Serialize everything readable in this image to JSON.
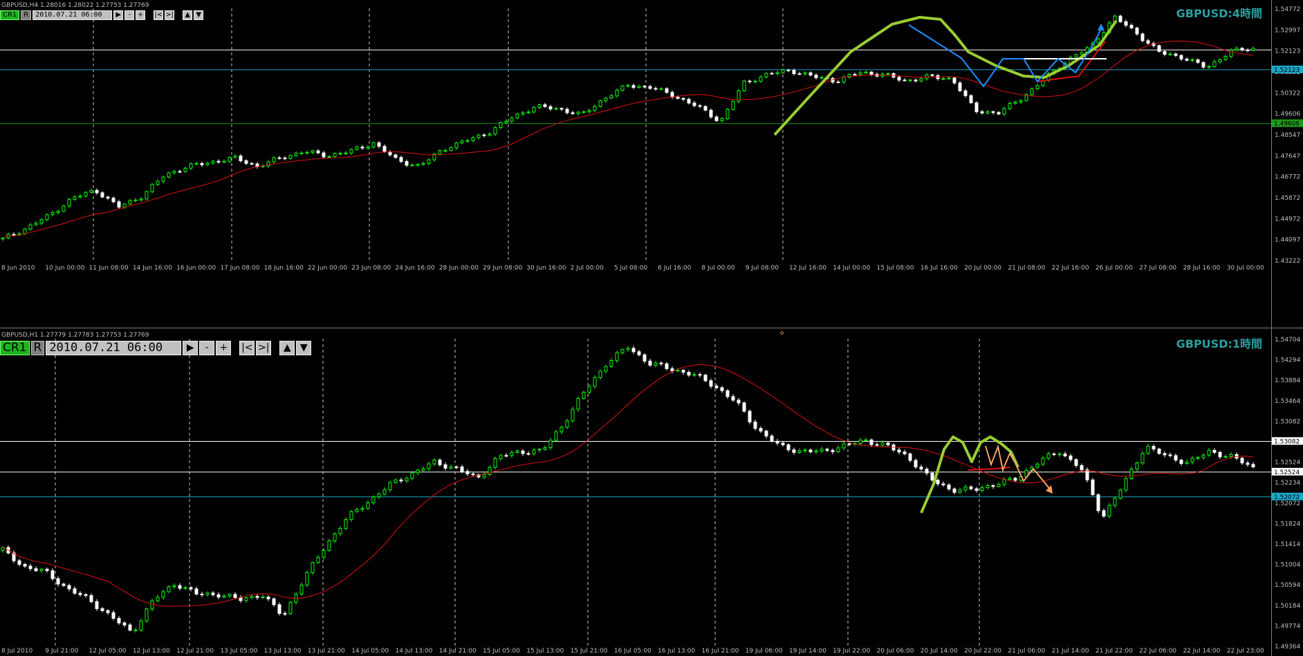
{
  "panels": [
    {
      "header": "GBPUSD,H4  1.28016 1.28022 1.27753 1.27769",
      "watermark": "GBPUSD:4時間",
      "toolbar": {
        "tag": "CR1",
        "r": "R",
        "datetime": "2010.07.21 06:00",
        "btn_next": "▶",
        "btn_minus": "-",
        "btn_plus": "+",
        "btn_first": "|<",
        "btn_last": ">|",
        "btn_up": "▲",
        "btn_down": "▼"
      },
      "price_labels": [
        "1.54772",
        "1.52997",
        "1.52123",
        "1.51222",
        "1.50322",
        "1.49606",
        "1.48547",
        "1.47647",
        "1.46772",
        "1.45872",
        "1.44972",
        "1.44097",
        "1.43222"
      ],
      "time_labels": [
        "8 Jun 2010",
        "10 Jun 00:00",
        "11 Jun 08:00",
        "14 Jun 16:00",
        "16 Jun 00:00",
        "17 Jun 08:00",
        "18 Jun 16:00",
        "22 Jun 00:00",
        "23 Jun 08:00",
        "24 Jun 16:00",
        "28 Jun 00:00",
        "29 Jun 08:00",
        "30 Jun 16:00",
        "2 Jul 00:00",
        "5 Jul 08:00",
        "6 Jul 16:00",
        "8 Jul 00:00",
        "9 Jul 08:00",
        "12 Jul 16:00",
        "14 Jul 00:00",
        "15 Jul 08:00",
        "16 Jul 16:00",
        "20 Jul 00:00",
        "21 Jul 08:00",
        "22 Jul 16:00",
        "26 Jul 00:00",
        "27 Jul 08:00",
        "28 Jul 16:00",
        "30 Jul 00:00"
      ],
      "level_tags": [
        {
          "text": "1.52123",
          "color": "#1aa7c8"
        },
        {
          "text": "1.49606",
          "color": "#1c9a1c"
        }
      ],
      "chart_data": {
        "type": "candlestick",
        "symbol": "GBPUSD",
        "timeframe": "H4",
        "ylim": [
          1.43222,
          1.55
        ],
        "horizontal_levels": [
          {
            "price": 1.52123,
            "color": "#1aa7c8"
          },
          {
            "price": 1.49606,
            "color": "#1c9a1c"
          },
          {
            "price": 1.5305,
            "color": "#ffffff"
          }
        ],
        "close_path": [
          1.442,
          1.447,
          1.453,
          1.461,
          1.465,
          1.457,
          1.462,
          1.472,
          1.476,
          1.478,
          1.48,
          1.476,
          1.48,
          1.483,
          1.481,
          1.483,
          1.487,
          1.479,
          1.476,
          1.484,
          1.488,
          1.492,
          1.499,
          1.504,
          1.503,
          1.5,
          1.508,
          1.514,
          1.513,
          1.509,
          1.504,
          1.497,
          1.515,
          1.519,
          1.521,
          1.518,
          1.516,
          1.52,
          1.519,
          1.516,
          1.518,
          1.517,
          1.502,
          1.501,
          1.508,
          1.517,
          1.526,
          1.532,
          1.546,
          1.538,
          1.529,
          1.527,
          1.522,
          1.53,
          1.531
        ]
      }
    },
    {
      "header": "GBPUSD,H1  1.27779 1.27783 1.27753 1.27769",
      "watermark": "GBPUSD:1時間",
      "toolbar": {
        "tag": "CR1",
        "r": "R",
        "datetime": "2010.07.21 06:00",
        "btn_next": "▶",
        "btn_minus": "-",
        "btn_plus": "+",
        "btn_first": "|<",
        "btn_last": ">|",
        "btn_up": "▲",
        "btn_down": "▼"
      },
      "price_labels": [
        "1.54704",
        "1.54294",
        "1.53884",
        "1.53464",
        "1.53082",
        "1.52644",
        "1.52524",
        "1.52234",
        "1.52072",
        "1.51824",
        "1.51414",
        "1.51004",
        "1.50594",
        "1.50184",
        "1.49774",
        "1.49364"
      ],
      "time_labels": [
        "8 Jul 2010",
        "9 Jul 21:00",
        "12 Jul 05:00",
        "12 Jul 13:00",
        "12 Jul 21:00",
        "13 Jul 05:00",
        "13 Jul 13:00",
        "13 Jul 21:00",
        "14 Jul 05:00",
        "14 Jul 13:00",
        "14 Jul 21:00",
        "15 Jul 05:00",
        "15 Jul 13:00",
        "15 Jul 21:00",
        "16 Jul 05:00",
        "16 Jul 13:00",
        "16 Jul 21:00",
        "19 Jul 06:00",
        "19 Jul 14:00",
        "19 Jul 22:00",
        "20 Jul 06:00",
        "20 Jul 14:00",
        "20 Jul 22:00",
        "21 Jul 06:00",
        "21 Jul 14:00",
        "21 Jul 22:00",
        "22 Jul 06:00",
        "22 Jul 14:00",
        "22 Jul 23:00"
      ],
      "level_tags": [
        {
          "text": "1.53082",
          "color": "#ffffff"
        },
        {
          "text": "1.52524",
          "color": "#ffffff"
        },
        {
          "text": "1.52072",
          "color": "#1aa7c8"
        }
      ],
      "chart_data": {
        "type": "candlestick",
        "symbol": "GBPUSD",
        "timeframe": "H1",
        "ylim": [
          1.49364,
          1.5495
        ],
        "horizontal_levels": [
          {
            "price": 1.53082,
            "color": "#ffffff"
          },
          {
            "price": 1.52524,
            "color": "#ffffff"
          },
          {
            "price": 1.52072,
            "color": "#1aa7c8"
          }
        ],
        "close_path": [
          1.511,
          1.508,
          1.507,
          1.504,
          1.502,
          1.499,
          1.496,
          1.502,
          1.505,
          1.503,
          1.503,
          1.502,
          1.503,
          1.499,
          1.506,
          1.512,
          1.517,
          1.52,
          1.523,
          1.525,
          1.527,
          1.526,
          1.524,
          1.528,
          1.529,
          1.529,
          1.534,
          1.54,
          1.545,
          1.548,
          1.545,
          1.544,
          1.543,
          1.541,
          1.538,
          1.533,
          1.53,
          1.529,
          1.529,
          1.53,
          1.531,
          1.53,
          1.528,
          1.524,
          1.522,
          1.522,
          1.523,
          1.524,
          1.527,
          1.529,
          1.526,
          1.517,
          1.523,
          1.53,
          1.528,
          1.527,
          1.529,
          1.528,
          1.526
        ]
      }
    }
  ],
  "colors": {
    "background": "#000000",
    "bull": "#00ff00",
    "bear": "#ffffff",
    "ma": "#e01010",
    "annot_green": "#9acd32",
    "annot_blue": "#1e90ff",
    "annot_orange": "#f4a460",
    "text": "#c0c0c0",
    "watermark": "#2aa0a0"
  }
}
